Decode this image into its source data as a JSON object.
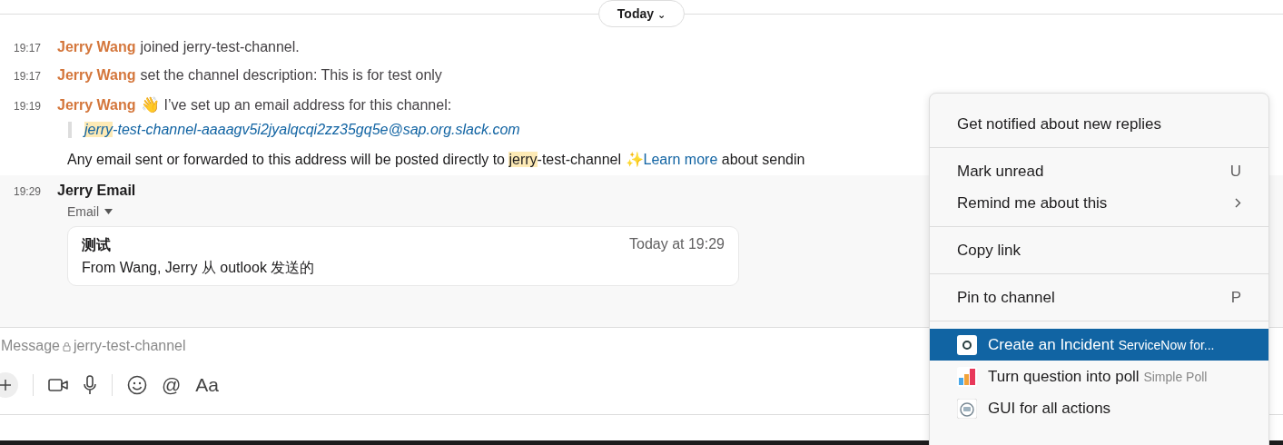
{
  "divider": {
    "label": "Today",
    "caret": "⌄"
  },
  "messages": [
    {
      "time": "19:17",
      "author": "Jerry Wang",
      "kind": "system",
      "text": "joined jerry-test-channel."
    },
    {
      "time": "19:17",
      "author": "Jerry Wang",
      "kind": "system",
      "text": "set the channel description: This is for test only"
    },
    {
      "time": "19:19",
      "author": "Jerry Wang",
      "kind": "email_setup",
      "emoji": "👋",
      "text": "I’ve set up an email address for this channel:",
      "address_highlight": "jerry",
      "address_rest": "-test-channel-aaaagv5i2jyalqcqi2zz35gq5e@sap.org.slack.com",
      "note_before": "Any email sent or forwarded to this address will be posted directly to",
      "note_highlight": "jerry",
      "note_channel": "-test-channel",
      "sparkle": "✨",
      "link": "Learn more",
      "note_after": "about sendin"
    },
    {
      "time": "19:29",
      "author": "Jerry Email",
      "kind": "email",
      "hovered": true,
      "label": "Email",
      "card": {
        "subject": "测试",
        "date": "Today at 19:29",
        "body": "From Wang, Jerry  从 outlook 发送的"
      }
    }
  ],
  "composer": {
    "placeholder": "Message",
    "channel": "jerry-test-channel",
    "tools": [
      {
        "kind": "plus"
      },
      {
        "kind": "divider"
      },
      {
        "kind": "video"
      },
      {
        "kind": "mic"
      },
      {
        "kind": "divider"
      },
      {
        "kind": "emoji"
      },
      {
        "kind": "text",
        "label": "@"
      },
      {
        "kind": "text",
        "label": "Aa"
      }
    ]
  },
  "menu": {
    "sections": [
      [
        {
          "kind": "plain",
          "label": "Get notified about new replies",
          "selected": false
        }
      ],
      [
        {
          "kind": "plain",
          "label": "Mark unread",
          "shortcut": "U",
          "selected": false
        },
        {
          "kind": "plain",
          "label": "Remind me about this",
          "submenu": true,
          "selected": false
        }
      ],
      [
        {
          "kind": "plain",
          "label": "Copy link",
          "selected": false
        }
      ],
      [
        {
          "kind": "plain",
          "label": "Pin to channel",
          "shortcut": "P",
          "selected": false
        }
      ],
      [
        {
          "kind": "app",
          "label": "Create an Incident",
          "app": "ServiceNow for...",
          "selected": true
        },
        {
          "kind": "app",
          "label": "Turn question into poll",
          "app": "Simple Poll",
          "selected": false
        },
        {
          "kind": "app",
          "label": "GUI for all actions",
          "selected": false
        }
      ]
    ]
  }
}
